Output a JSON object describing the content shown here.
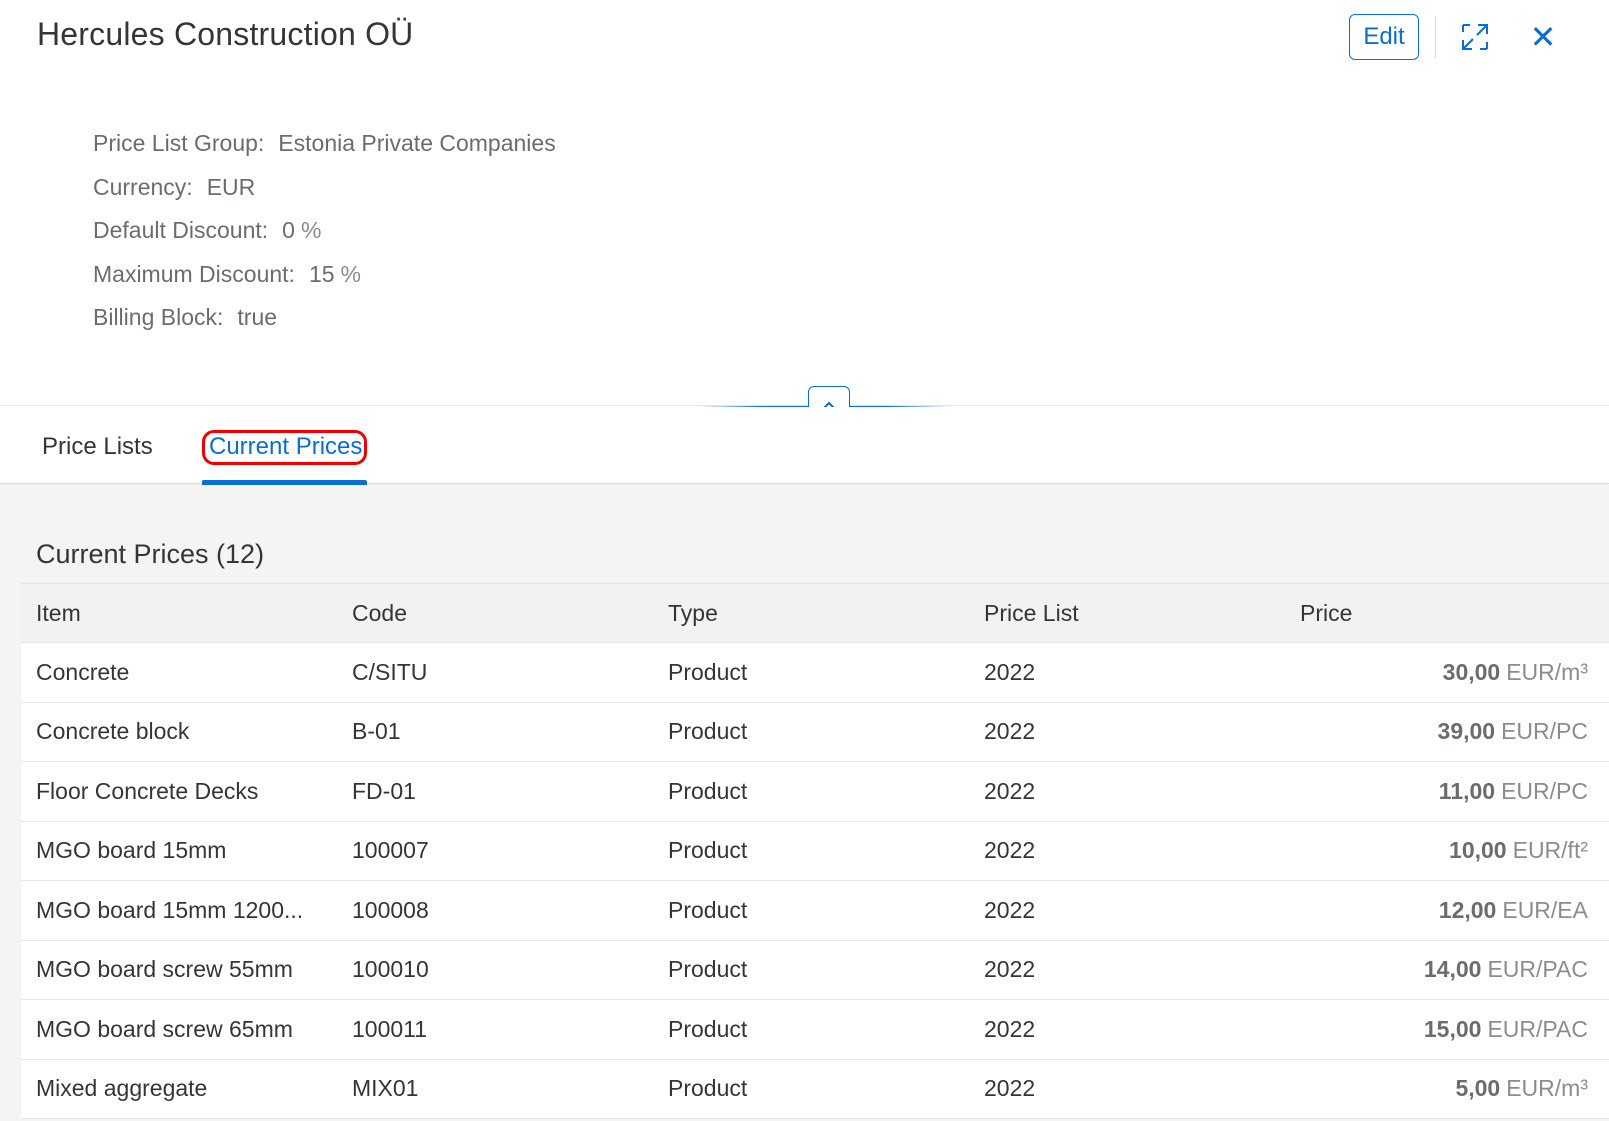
{
  "header": {
    "title": "Hercules Construction OÜ",
    "edit_label": "Edit",
    "fullscreen_icon": "expand-icon",
    "close_icon": "close-icon",
    "close_glyph": "✕",
    "attributes": [
      {
        "label": "Price List Group:",
        "value": "Estonia Private Companies",
        "unit": ""
      },
      {
        "label": "Currency:",
        "value": "EUR",
        "unit": ""
      },
      {
        "label": "Default Discount:",
        "value": "0",
        "unit": "%"
      },
      {
        "label": "Maximum Discount:",
        "value": "15",
        "unit": "%"
      },
      {
        "label": "Billing Block:",
        "value": "true",
        "unit": ""
      }
    ]
  },
  "tabs": [
    {
      "label": "Price Lists",
      "selected": false
    },
    {
      "label": "Current Prices",
      "selected": true
    }
  ],
  "table": {
    "title": "Current Prices (12)",
    "columns": [
      "Item",
      "Code",
      "Type",
      "Price List",
      "Price"
    ],
    "rows": [
      {
        "item": "Concrete",
        "code": "C/SITU",
        "type": "Product",
        "price_list": "2022",
        "price": "30,00",
        "unit": "EUR/m³"
      },
      {
        "item": "Concrete block",
        "code": "B-01",
        "type": "Product",
        "price_list": "2022",
        "price": "39,00",
        "unit": "EUR/PC"
      },
      {
        "item": "Floor Concrete Decks",
        "code": "FD-01",
        "type": "Product",
        "price_list": "2022",
        "price": "11,00",
        "unit": "EUR/PC"
      },
      {
        "item": "MGO board 15mm",
        "code": "100007",
        "type": "Product",
        "price_list": "2022",
        "price": "10,00",
        "unit": "EUR/ft²"
      },
      {
        "item": "MGO board 15mm 1200...",
        "code": "100008",
        "type": "Product",
        "price_list": "2022",
        "price": "12,00",
        "unit": "EUR/EA"
      },
      {
        "item": "MGO board screw 55mm",
        "code": "100010",
        "type": "Product",
        "price_list": "2022",
        "price": "14,00",
        "unit": "EUR/PAC"
      },
      {
        "item": "MGO board screw 65mm",
        "code": "100011",
        "type": "Product",
        "price_list": "2022",
        "price": "15,00",
        "unit": "EUR/PAC"
      },
      {
        "item": "Mixed aggregate",
        "code": "MIX01",
        "type": "Product",
        "price_list": "2022",
        "price": "5,00",
        "unit": "EUR/m³"
      }
    ]
  },
  "colors": {
    "accent": "#0a6ed1",
    "focus_outline": "#ee0000",
    "text": "#32363a",
    "muted": "#6a6d70",
    "content_bg": "#f4f4f4"
  }
}
